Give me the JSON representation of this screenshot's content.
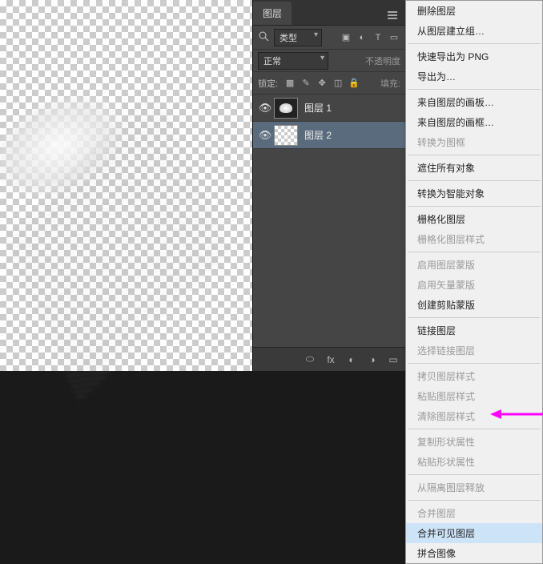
{
  "panel": {
    "tab_label": "图层",
    "filter": {
      "type_label": "类型"
    },
    "blend": {
      "mode": "正常",
      "opacity_label": "不透明度"
    },
    "lock": {
      "label": "锁定:",
      "fill_label": "填充:"
    },
    "layers": [
      {
        "name": "图层 1"
      },
      {
        "name": "图层 2"
      }
    ]
  },
  "menu": {
    "items": [
      {
        "label": "删除图层",
        "disabled": false
      },
      {
        "label": "从图层建立组…",
        "disabled": false
      },
      {
        "sep": true
      },
      {
        "label": "快速导出为 PNG",
        "disabled": false
      },
      {
        "label": "导出为…",
        "disabled": false
      },
      {
        "sep": true
      },
      {
        "label": "来自图层的画板…",
        "disabled": false
      },
      {
        "label": "来自图层的画框…",
        "disabled": false
      },
      {
        "label": "转换为图框",
        "disabled": true
      },
      {
        "sep": true
      },
      {
        "label": "遮住所有对象",
        "disabled": false
      },
      {
        "sep": true
      },
      {
        "label": "转换为智能对象",
        "disabled": false
      },
      {
        "sep": true
      },
      {
        "label": "栅格化图层",
        "disabled": false
      },
      {
        "label": "栅格化图层样式",
        "disabled": true
      },
      {
        "sep": true
      },
      {
        "label": "启用图层蒙版",
        "disabled": true
      },
      {
        "label": "启用矢量蒙版",
        "disabled": true
      },
      {
        "label": "创建剪贴蒙版",
        "disabled": false
      },
      {
        "sep": true
      },
      {
        "label": "链接图层",
        "disabled": false
      },
      {
        "label": "选择链接图层",
        "disabled": true
      },
      {
        "sep": true
      },
      {
        "label": "拷贝图层样式",
        "disabled": true
      },
      {
        "label": "粘贴图层样式",
        "disabled": true
      },
      {
        "label": "清除图层样式",
        "disabled": true
      },
      {
        "sep": true
      },
      {
        "label": "复制形状属性",
        "disabled": true
      },
      {
        "label": "粘贴形状属性",
        "disabled": true
      },
      {
        "sep": true
      },
      {
        "label": "从隔离图层释放",
        "disabled": true
      },
      {
        "sep": true
      },
      {
        "label": "合并图层",
        "disabled": true
      },
      {
        "label": "合并可见图层",
        "disabled": false,
        "highlighted": true
      },
      {
        "label": "拼合图像",
        "disabled": false
      }
    ]
  },
  "colors": {
    "arrow": "#ff00ff"
  }
}
